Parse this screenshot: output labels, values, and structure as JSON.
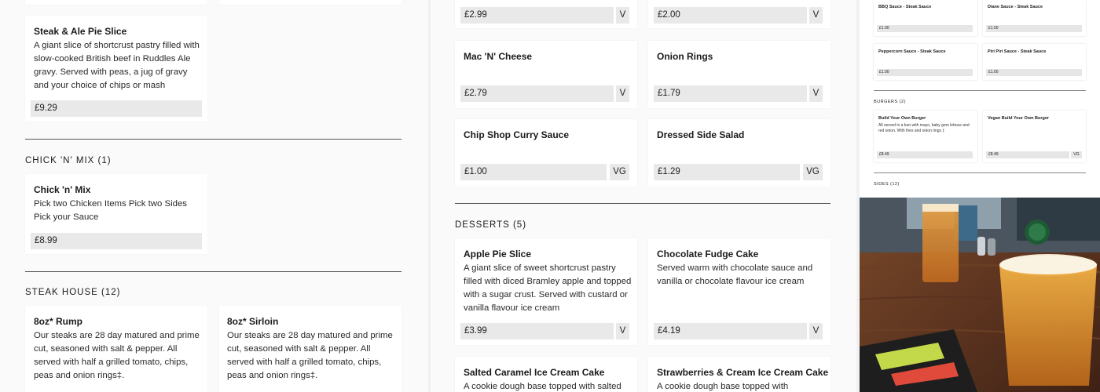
{
  "left": {
    "steak_ale": {
      "title": "Steak & Ale Pie Slice",
      "desc": "A giant slice of shortcrust pastry filled with slow-cooked British beef in Ruddles Ale gravy. Served with peas, a jug of gravy and your choice of chips or mash",
      "price": "£9.29"
    },
    "chick_section": "CHICK 'N' MIX (1)",
    "chick_mix": {
      "title": "Chick 'n' Mix",
      "desc": "Pick two Chicken Items Pick two Sides Pick your Sauce",
      "price": "£8.99"
    },
    "steak_section": "STEAK HOUSE (12)",
    "rump": {
      "title": "8oz* Rump",
      "desc": "Our steaks are 28 day matured and prime cut, seasoned with salt & pepper. All served with half a grilled tomato, chips, peas and onion rings‡."
    },
    "sirloin": {
      "title": "8oz* Sirloin",
      "desc": "Our steaks are 28 day matured and prime cut, seasoned with salt & pepper. All served with half a grilled tomato, chips, peas and onion rings‡."
    }
  },
  "middle": {
    "top_left_price": "£2.99",
    "top_left_tag": "V",
    "top_right_price": "£2.00",
    "top_right_tag": "V",
    "mac": {
      "title": "Mac 'N' Cheese",
      "price": "£2.79",
      "tag": "V"
    },
    "onion": {
      "title": "Onion Rings",
      "price": "£1.79",
      "tag": "V"
    },
    "curry": {
      "title": "Chip Shop Curry Sauce",
      "price": "£1.00",
      "tag": "VG"
    },
    "salad": {
      "title": "Dressed Side Salad",
      "price": "£1.29",
      "tag": "VG"
    },
    "desserts_section": "DESSERTS (5)",
    "apple": {
      "title": "Apple Pie Slice",
      "desc": "A giant slice of sweet shortcrust pastry filled with diced Bramley apple and topped with a sugar crust. Served with custard or vanilla flavour ice cream",
      "price": "£3.99",
      "tag": "V"
    },
    "fudge": {
      "title": "Chocolate Fudge Cake",
      "desc": "Served warm with chocolate sauce and vanilla or chocolate flavour ice cream",
      "price": "£4.19",
      "tag": "V"
    },
    "caramel": {
      "title": "Salted Caramel Ice Cream Cake",
      "desc": "A cookie dough base topped with salted"
    },
    "strawberry": {
      "title": "Strawberries & Cream Ice Cream Cake",
      "desc": "A cookie dough base topped with strawberry"
    }
  },
  "mini": {
    "bbq": {
      "title": "BBQ Sauce - Steak Sauce",
      "price": "£1.00"
    },
    "diane": {
      "title": "Diane Sauce - Steak Sauce",
      "price": "£1.00"
    },
    "pepper": {
      "title": "Peppercorn Sauce - Steak Sauce",
      "price": "£1.00"
    },
    "piri": {
      "title": "Piri Piri Sauce - Steak Sauce",
      "price": "£1.00"
    },
    "burgers_section": "BURGERS (2)",
    "byo": {
      "title": "Build Your Own Burger",
      "desc": "All served in a bun with mayo, baby gem lettuce and red onion. With fries and onion rings ‡",
      "price": "£8.49"
    },
    "vegan": {
      "title": "Vegan Build Your Own Burger",
      "price": "£8.49",
      "tag": "VG"
    },
    "sides_section": "SIDES (12)"
  },
  "photo": {
    "subject": "pub-table-with-beers-and-menu"
  }
}
